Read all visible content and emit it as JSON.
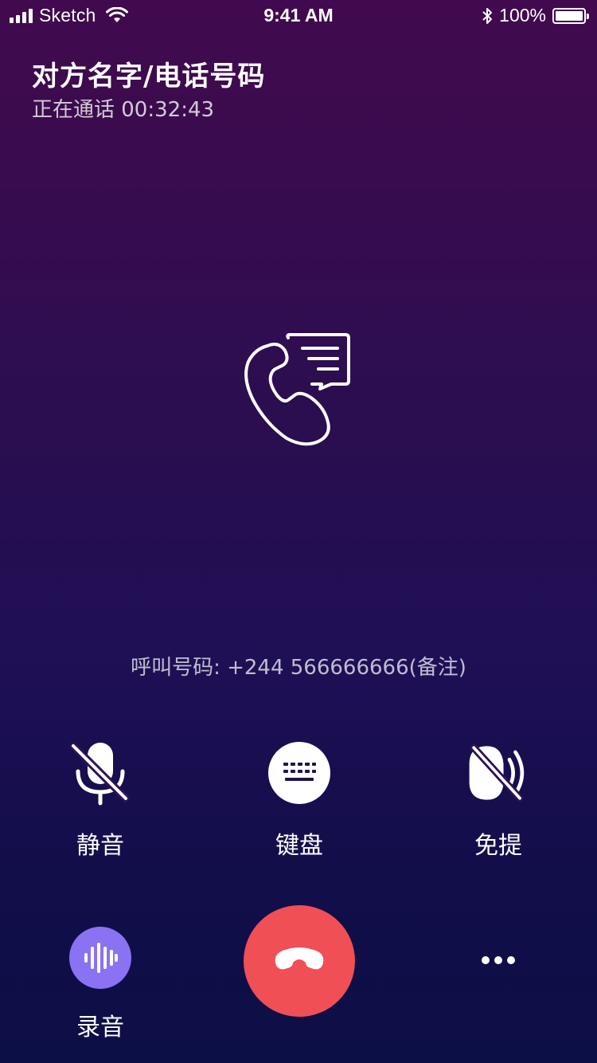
{
  "status_bar": {
    "carrier": "Sketch",
    "time": "9:41 AM",
    "battery": "100%",
    "icons": [
      "signal-icon",
      "wifi-icon",
      "bluetooth-icon",
      "battery-icon"
    ]
  },
  "call": {
    "title": "对方名字/电话号码",
    "status": "正在通话 00:32:43",
    "number_line": "呼叫号码: +244 566666666(备注)",
    "center_icon": "call-message-icon"
  },
  "controls": {
    "mute": {
      "label": "静音",
      "icon": "mic-off-icon"
    },
    "keypad": {
      "label": "键盘",
      "icon": "keyboard-icon"
    },
    "speaker": {
      "label": "免提",
      "icon": "speaker-off-icon"
    },
    "record": {
      "label": "录音",
      "icon": "waveform-icon"
    },
    "hangup": {
      "icon": "hang-up-icon"
    },
    "more": {
      "icon": "more-dots-icon"
    }
  },
  "colors": {
    "bg_top": "#420a4e",
    "bg_bottom": "#0c0f45",
    "hangup": "#f04f55",
    "record": "#8a72f3"
  }
}
